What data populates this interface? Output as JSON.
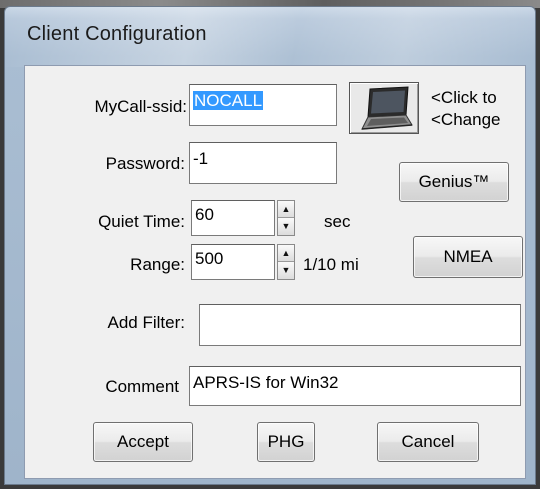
{
  "window": {
    "title": "Client Configuration"
  },
  "form": {
    "mycall": {
      "label": "MyCall-ssid:",
      "value": "NOCALL"
    },
    "password": {
      "label": "Password:",
      "value": "-1"
    },
    "quiet_time": {
      "label": "Quiet Time:",
      "value": "60",
      "unit": "sec"
    },
    "range": {
      "label": "Range:",
      "value": "500",
      "unit": "1/10 mi"
    },
    "add_filter": {
      "label": "Add Filter:",
      "value": ""
    },
    "comment": {
      "label": "Comment",
      "value": "APRS-IS for Win32"
    }
  },
  "symbol": {
    "icon": "laptop-icon",
    "hint_line1": "<Click to",
    "hint_line2": "<Change"
  },
  "buttons": {
    "genius": "Genius™",
    "nmea": "NMEA",
    "accept": "Accept",
    "phg": "PHG",
    "cancel": "Cancel"
  }
}
